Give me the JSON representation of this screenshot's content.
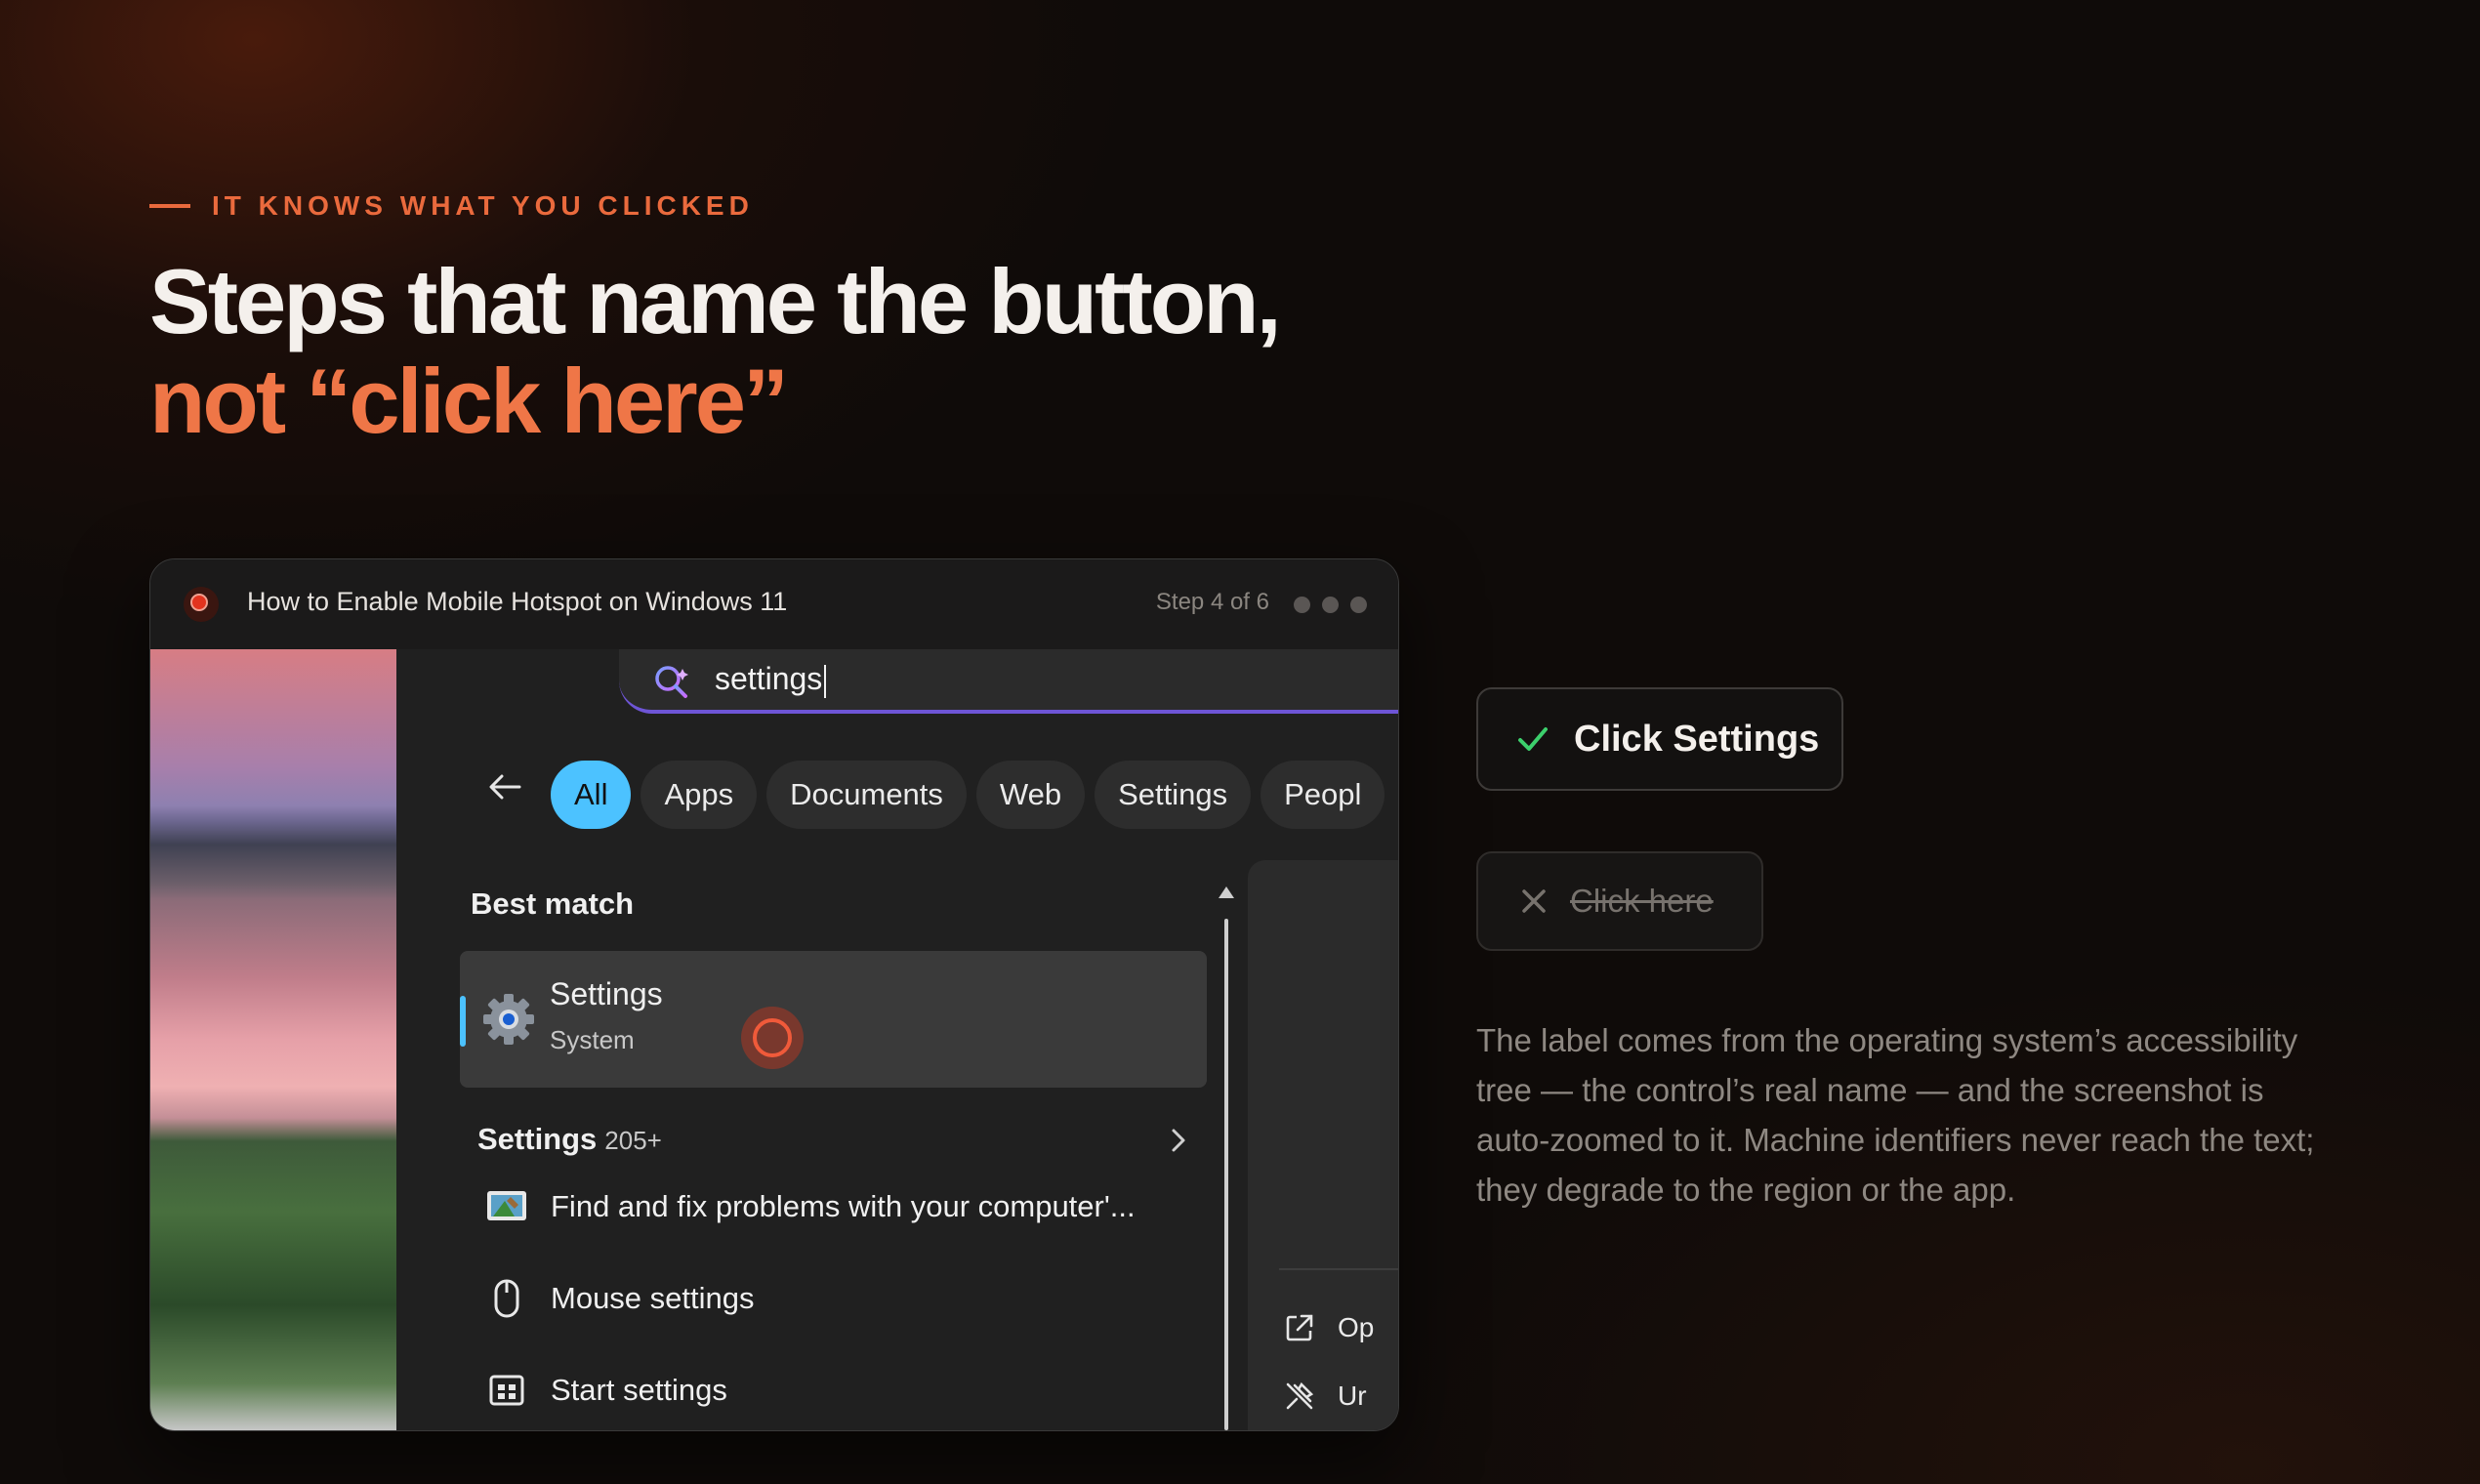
{
  "eyebrow": "IT KNOWS WHAT YOU CLICKED",
  "headline": {
    "line1": "Steps that name the button,",
    "line2": "not “click here”"
  },
  "window": {
    "title": "How to Enable Mobile Hotspot on Windows 11",
    "step": "Step 4 of 6",
    "search_value": "settings",
    "chips": [
      "All",
      "Apps",
      "Documents",
      "Web",
      "Settings",
      "Peopl"
    ],
    "active_chip": "All",
    "best_match_label": "Best match",
    "best_match": {
      "name": "Settings",
      "sub": "System"
    },
    "settings_section": {
      "label": "Settings",
      "count": "205+"
    },
    "results": [
      "Find and fix problems with your computer'...",
      "Mouse settings",
      "Start settings"
    ],
    "right_pane": [
      "Op",
      "Ur"
    ],
    "icons": [
      "search-icon",
      "back-arrow-icon",
      "gear-icon",
      "chevron-right-icon",
      "troubleshoot-icon",
      "mouse-icon",
      "start-icon",
      "open-icon",
      "unpin-icon"
    ]
  },
  "callouts": {
    "good": {
      "label": "Click Settings",
      "icon": "check-icon",
      "color": "#3ccf6c"
    },
    "bad": {
      "label": "Click here",
      "icon": "x-icon"
    },
    "description": "The label comes from the operating system’s accessibility tree — the control’s real name — and the screenshot is auto-zoomed to it. Machine identifiers never reach the text; they degrade to the region or the app."
  },
  "colors": {
    "accent": "#ea6a3d",
    "headline_accent": "#ef7647",
    "chip_active": "#4cc2ff",
    "search_underline": "#6e55d6"
  }
}
